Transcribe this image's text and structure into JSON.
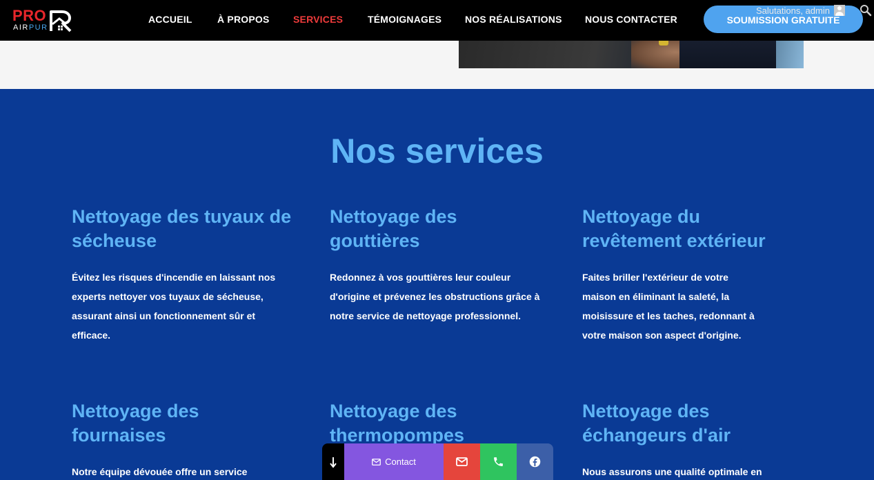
{
  "header": {
    "logo": {
      "pro": "PRO",
      "air": "AIR",
      "pur": "PUR"
    },
    "nav": [
      {
        "label": "ACCUEIL",
        "active": false
      },
      {
        "label": "À PROPOS",
        "active": false
      },
      {
        "label": "SERVICES",
        "active": true
      },
      {
        "label": "TÉMOIGNAGES",
        "active": false
      },
      {
        "label": "NOS RÉALISATIONS",
        "active": false
      },
      {
        "label": "NOUS CONTACTER",
        "active": false
      }
    ],
    "cta_label": "SOUMISSION GRATUITE",
    "greeting": "Salutations, admin"
  },
  "services": {
    "title": "Nos services",
    "items": [
      {
        "title": "Nettoyage des tuyaux de sécheuse",
        "text": "Évitez les risques d'incendie en laissant nos experts nettoyer vos tuyaux de sécheuse, assurant ainsi un fonctionnement sûr et efficace."
      },
      {
        "title": "Nettoyage des gouttières",
        "text": "Redonnez à vos gouttières leur couleur d'origine et prévenez les obstructions grâce à notre service de nettoyage professionnel."
      },
      {
        "title": "Nettoyage du revêtement extérieur",
        "text": "Faites briller l'extérieur de votre maison en éliminant la saleté, la moisissure et les taches, redonnant à votre maison son aspect d'origine."
      },
      {
        "title": "Nettoyage des fournaises",
        "text": "Notre équipe dévouée offre un service"
      },
      {
        "title": "Nettoyage des thermopompes",
        "text": ""
      },
      {
        "title": "Nettoyage des échangeurs d'air",
        "text": "Nous assurons une qualité optimale en"
      }
    ]
  },
  "floating_bar": {
    "contact_label": "Contact"
  },
  "colors": {
    "section_bg": "#0a3a95",
    "accent_blue": "#5fb4f5",
    "nav_active": "#ef3b3b",
    "cta_bg": "#4fa3ef"
  }
}
